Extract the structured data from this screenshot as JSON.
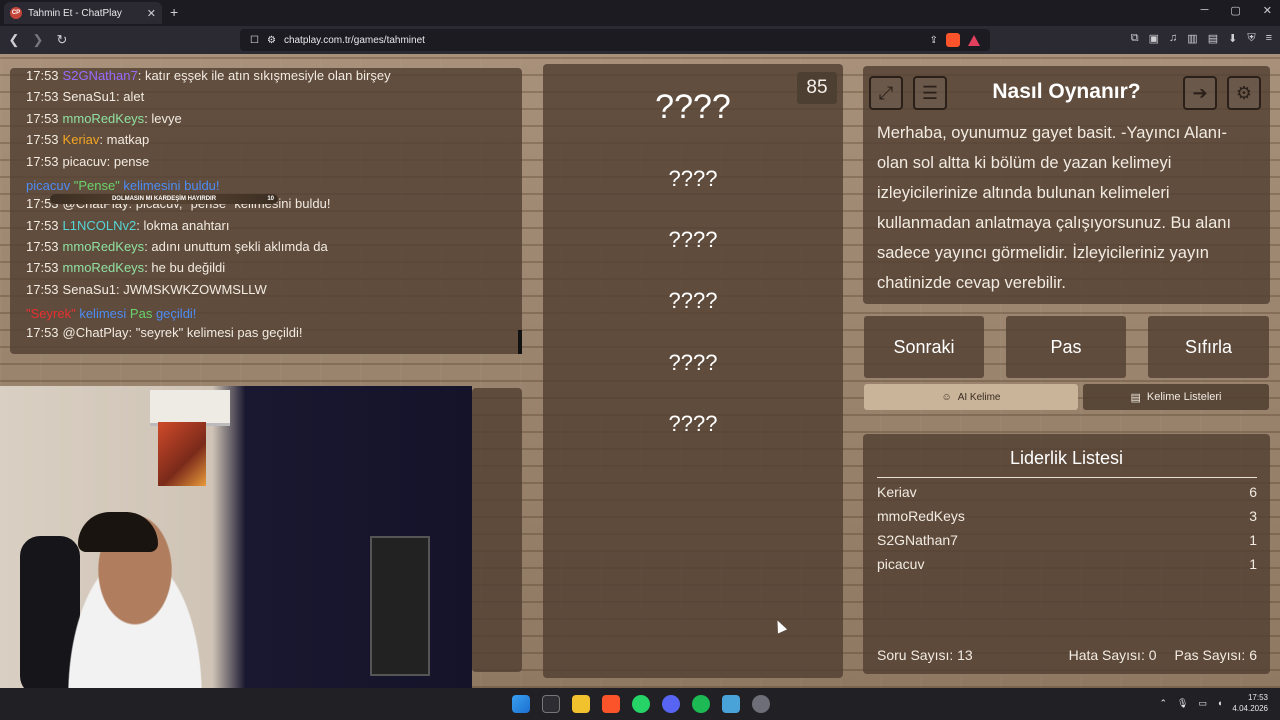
{
  "browser": {
    "tab_title": "Tahmin Et - ChatPlay",
    "tab_favicon": "CP",
    "new_tab": "+",
    "url": "chatplay.com.tr/games/tahminet"
  },
  "chat": {
    "lines": [
      {
        "time": "17:53",
        "user": "S2GNathan7",
        "msg": ": katır eşşek ile atın sıkışmesiyle olan birşey",
        "color": "#9b6bff"
      },
      {
        "time": "17:53",
        "user": "SenaSu1",
        "msg": ": alet",
        "color": "#f2ebe2"
      },
      {
        "time": "17:53",
        "user": "mmoRedKeys",
        "msg": ": levye",
        "color": "#8fe0a0"
      },
      {
        "time": "17:53",
        "user": "Keriav",
        "msg": ": matkap",
        "color": "#f5a623"
      },
      {
        "time": "17:53",
        "user": "picacuv",
        "msg": ": pense",
        "color": "#f2ebe2"
      },
      {
        "time": "",
        "user": "",
        "msg": "",
        "color": "#f2ebe2"
      },
      {
        "time": "17:53",
        "user": "@ChatPlay",
        "msg": ": picacuv, \"pense\" kelimesini buldu!",
        "color": "#f2ebe2"
      },
      {
        "time": "17:53",
        "user": "L1NCOLNv2",
        "msg": ": lokma anahtarı",
        "color": "#55d6d6"
      },
      {
        "time": "17:53",
        "user": "mmoRedKeys",
        "msg": ": adını unuttum şekli aklımda da",
        "color": "#8fe0a0"
      },
      {
        "time": "17:53",
        "user": "mmoRedKeys",
        "msg": ": he bu değildi",
        "color": "#8fe0a0"
      },
      {
        "time": "17:53",
        "user": "SenaSu1",
        "msg": ": JWMSKWKZOWMSLLW",
        "color": "#f2ebe2"
      },
      {
        "time": "",
        "user": "",
        "msg": "",
        "color": "#f2ebe2"
      },
      {
        "time": "17:53",
        "user": "@ChatPlay",
        "msg": ": \"seyrek\" kelimesi pas geçildi!",
        "color": "#f2ebe2"
      }
    ],
    "highlight_found": {
      "user": "picacuv",
      "word": "\"Pense\"",
      "rest": "kelimesini buldu!"
    },
    "highlight_pass": {
      "word": "\"Seyrek\"",
      "mid": "kelimesi",
      "pas": "Pas",
      "rest": "geçildi!"
    },
    "banner_text": "DOLMASIN MI KARDEŞİM HAYIRDIR",
    "banner_count": "10"
  },
  "words": {
    "counter": "85",
    "items": [
      "????",
      "????",
      "????",
      "????",
      "????",
      "????"
    ]
  },
  "howto": {
    "title": "Nasıl Oynanır?",
    "text": "Merhaba, oyunumuz gayet basit. -Yayıncı Alanı- olan sol altta ki bölüm de yazan kelimeyi izleyicilerinize altında bulunan kelimeleri kullanmadan anlatmaya çalışıyorsunuz. Bu alanı sadece yayıncı görmelidir. İzleyicileriniz yayın chatinizde cevap verebilir."
  },
  "actions": {
    "next": "Sonraki",
    "pass": "Pas",
    "reset": "Sıfırla",
    "ai_word": "AI Kelime",
    "word_lists": "Kelime Listeleri"
  },
  "leaderboard": {
    "title": "Liderlik Listesi",
    "rows": [
      {
        "name": "Keriav",
        "score": "6"
      },
      {
        "name": "mmoRedKeys",
        "score": "3"
      },
      {
        "name": "S2GNathan7",
        "score": "1"
      },
      {
        "name": "picacuv",
        "score": "1"
      }
    ],
    "questions": "Soru Sayısı: 13",
    "errors": "Hata Sayısı: 0",
    "passes": "Pas Sayısı: 6"
  },
  "taskbar": {
    "time": "17:53",
    "date": "4.04.2026"
  }
}
